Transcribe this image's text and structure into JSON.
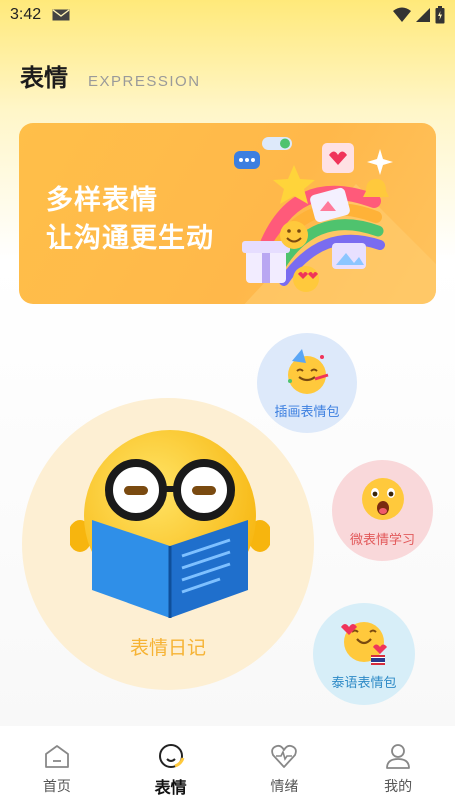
{
  "status_bar": {
    "time": "3:42",
    "icons": [
      "mail-icon",
      "wifi-icon",
      "signal-icon",
      "battery-icon"
    ]
  },
  "header": {
    "title": "表情",
    "subtitle": "EXPRESSION"
  },
  "banner": {
    "line1": "多样表情",
    "line2": "让沟通更生动"
  },
  "featured": {
    "label": "表情日记"
  },
  "bubbles": [
    {
      "label": "插画表情包",
      "color": "#3C7FE0"
    },
    {
      "label": "微表情学习",
      "color": "#E2595A"
    },
    {
      "label": "泰语表情包",
      "color": "#2E8AC6"
    }
  ],
  "tabbar": {
    "tabs": [
      {
        "label": "首页",
        "icon": "home-icon",
        "active": false
      },
      {
        "label": "表情",
        "icon": "emoji-icon",
        "active": true
      },
      {
        "label": "情绪",
        "icon": "heart-pulse-icon",
        "active": false
      },
      {
        "label": "我的",
        "icon": "user-icon",
        "active": false
      }
    ]
  },
  "colors": {
    "banner": "#FFBF49",
    "accent_yellow": "#F6B334",
    "header_gradient_top": "#FFE97A"
  }
}
